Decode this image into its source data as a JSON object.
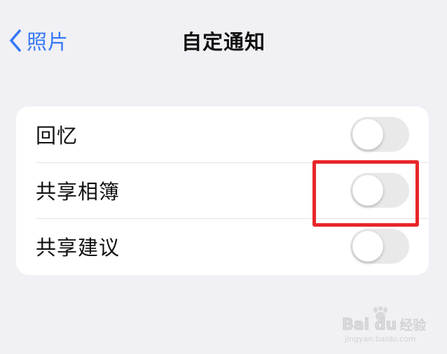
{
  "nav": {
    "back_label": "照片",
    "title": "自定通知"
  },
  "settings": {
    "items": [
      {
        "label": "回忆",
        "toggle": "off"
      },
      {
        "label": "共享相簿",
        "toggle": "off",
        "highlighted": true
      },
      {
        "label": "共享建议",
        "toggle": "off"
      }
    ]
  },
  "icons": {
    "back": "chevron-left-icon",
    "watermark": "baidu-paw-icon"
  },
  "colors": {
    "accent": "#3478f6",
    "background": "#f0f0f5",
    "card": "#ffffff",
    "toggle_off": "#e9e9ea",
    "highlight": "#e8262a"
  },
  "watermark": {
    "brand": "Bai du",
    "suffix": "经验",
    "url": "jingyan.baidu.com"
  }
}
